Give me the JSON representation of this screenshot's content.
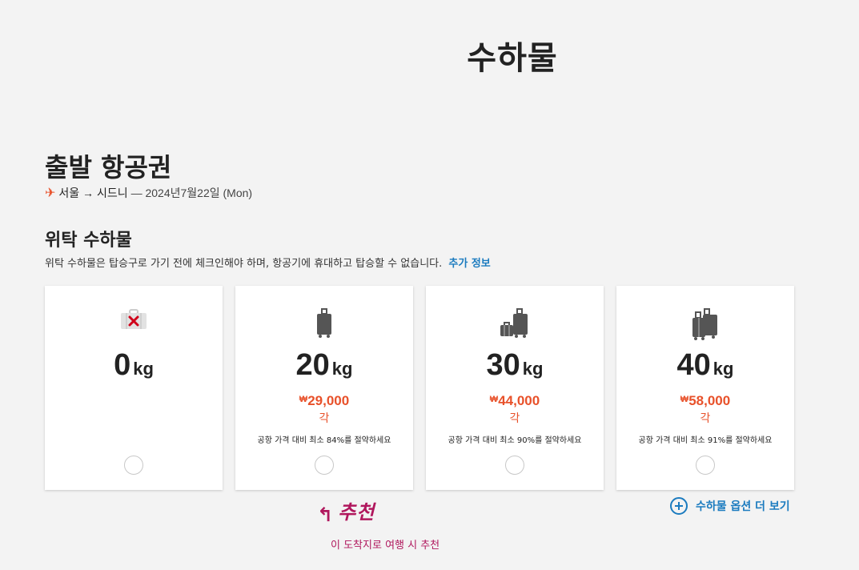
{
  "header": {
    "title": "수하물"
  },
  "flight": {
    "title": "출발 항공권",
    "route": "서울 → 시드니",
    "date": "— 2024년7월22일 (Mon)"
  },
  "checked_baggage": {
    "title": "위탁 수하물",
    "description": "위탁 수하물은 탑승구로 가기 전에 체크인해야 하며, 항공기에 휴대하고 탑승할 수 없습니다.",
    "more_info_label": "추가 정보"
  },
  "options": [
    {
      "weight": "0",
      "unit": "kg",
      "currency": "",
      "price": "",
      "per": "",
      "savings": "",
      "icon": "no-baggage-icon"
    },
    {
      "weight": "20",
      "unit": "kg",
      "currency": "₩",
      "price": "29,000",
      "per": "각",
      "savings": "공항 가격 대비 최소 84%를 절약하세요",
      "icon": "suitcase-icon"
    },
    {
      "weight": "30",
      "unit": "kg",
      "currency": "₩",
      "price": "44,000",
      "per": "각",
      "savings": "공항 가격 대비 최소 90%를 절약하세요",
      "icon": "two-suitcases-icon"
    },
    {
      "weight": "40",
      "unit": "kg",
      "currency": "₩",
      "price": "58,000",
      "per": "각",
      "savings": "공항 가격 대비 최소 91%를 절약하세요",
      "icon": "large-suitcases-icon"
    }
  ],
  "more_options_label": "수하물 옵션 더 보기",
  "recommendation": {
    "label": "추천",
    "note": "이 도착지로 여행 시 추천"
  },
  "colors": {
    "accent": "#e8512a",
    "link": "#1b7bbf",
    "recommend": "#b0175d"
  }
}
